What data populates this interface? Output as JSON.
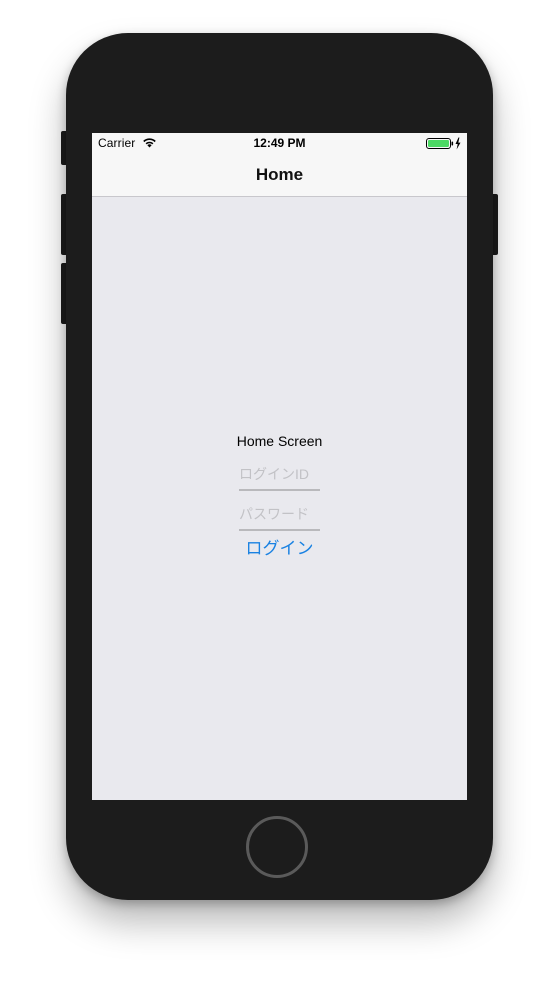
{
  "status_bar": {
    "carrier": "Carrier",
    "time": "12:49 PM",
    "wifi_icon": "wifi-icon",
    "battery_icon": "battery-charging-icon",
    "battery_level": 1.0,
    "battery_color": "#4cd964"
  },
  "nav_bar": {
    "title": "Home"
  },
  "content": {
    "screen_label": "Home Screen",
    "login_id_placeholder": "ログインID",
    "password_placeholder": "パスワード",
    "login_button_label": "ログイン"
  },
  "colors": {
    "accent": "#1a82e2",
    "background": "#e9e9ee",
    "bar_background": "#f7f7f7"
  }
}
